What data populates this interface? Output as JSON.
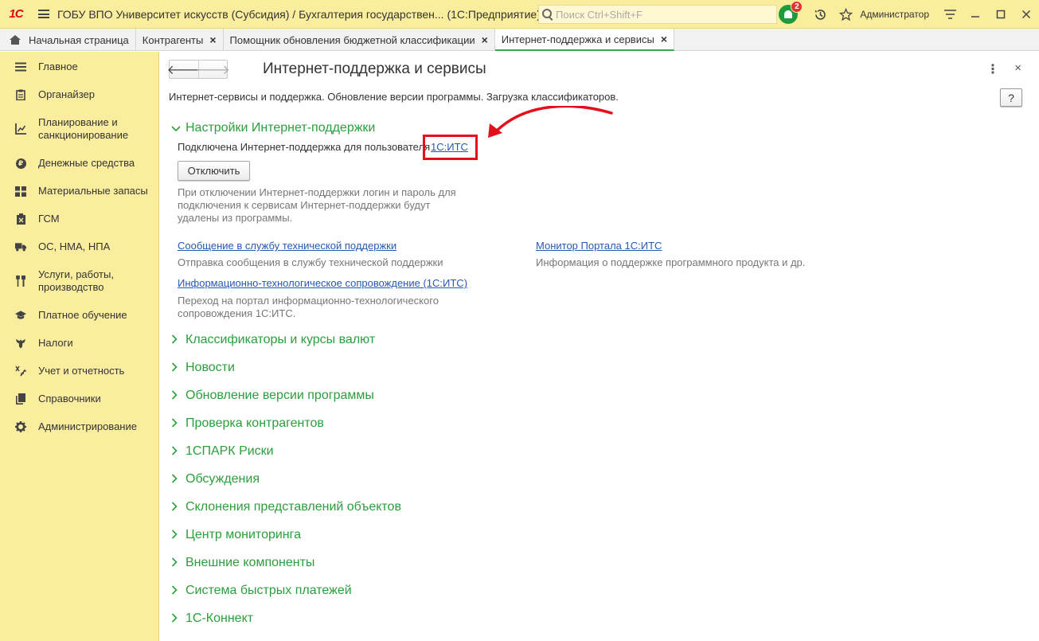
{
  "app": {
    "logo": "1С",
    "title": "ГОБУ ВПО Университет искусств (Субсидия) / Бухгалтерия государствен...  (1С:Предприятие)",
    "search_placeholder": "Поиск Ctrl+Shift+F",
    "notifications_count": "2",
    "user": "Администратор",
    "accent_color": "#2b9e3d",
    "panel_color": "#fbed9e"
  },
  "tabs": [
    {
      "label": "Начальная страница",
      "icon": "home-icon"
    },
    {
      "label": "Контрагенты"
    },
    {
      "label": "Помощник обновления бюджетной классификации"
    },
    {
      "label": "Интернет-поддержка и сервисы",
      "active": true
    }
  ],
  "sidebar": {
    "items": [
      {
        "label": "Главное",
        "icon": "menu-icon"
      },
      {
        "label": "Органайзер",
        "icon": "clipboard-icon"
      },
      {
        "label": "Планирование и санкционирование",
        "icon": "planning-icon"
      },
      {
        "label": "Денежные средства",
        "icon": "ruble-coin-icon"
      },
      {
        "label": "Материальные запасы",
        "icon": "stock-grid-icon"
      },
      {
        "label": "ГСМ",
        "icon": "fuel-can-icon"
      },
      {
        "label": "ОС, НМА, НПА",
        "icon": "truck-icon"
      },
      {
        "label": "Услуги, работы, производство",
        "icon": "tools-icon"
      },
      {
        "label": "Платное обучение",
        "icon": "graduation-cap-icon"
      },
      {
        "label": "Налоги",
        "icon": "eagle-emblem-icon"
      },
      {
        "label": "Учет и отчетность",
        "icon": "accounting-icon"
      },
      {
        "label": "Справочники",
        "icon": "directory-icon"
      },
      {
        "label": "Администрирование",
        "icon": "gear-icon"
      }
    ]
  },
  "main": {
    "title": "Интернет-поддержка и сервисы",
    "description": "Интернет-сервисы и поддержка. Обновление версии программы. Загрузка классификаторов.",
    "help_label": "?",
    "more_label": "⋮",
    "close_label": "×",
    "back_label": "🡐",
    "forward_label": "🡒",
    "support_section": {
      "title": "Настройки Интернет-поддержки",
      "connected_text": "Подключена Интернет-поддержка для пользователя",
      "user_link": "1С:ИТС",
      "disconnect_button": "Отключить",
      "disconnect_note": "При отключении Интернет-поддержки логин и пароль для подключения к сервисам Интернет-поддержки будут удалены из программы.",
      "links": [
        {
          "label": "Сообщение в службу технической поддержки",
          "description": "Отправка сообщения в службу технической поддержки"
        },
        {
          "label": "Монитор Портала 1С:ИТС",
          "description": "Информация о поддержке программного продукта и др."
        },
        {
          "label": "Информационно-технологическое сопровождение (1С:ИТС)",
          "description": "Переход на портал информационно-технологического сопровождения 1С:ИТС."
        }
      ]
    },
    "sections": [
      "Классификаторы и курсы валют",
      "Новости",
      "Обновление версии программы",
      "Проверка контрагентов",
      "1СПАРК Риски",
      "Обсуждения",
      "Склонения представлений объектов",
      "Центр мониторинга",
      "Внешние компоненты",
      "Система быстрых платежей",
      "1С-Коннект"
    ],
    "annotation_color": "#e3101c"
  }
}
